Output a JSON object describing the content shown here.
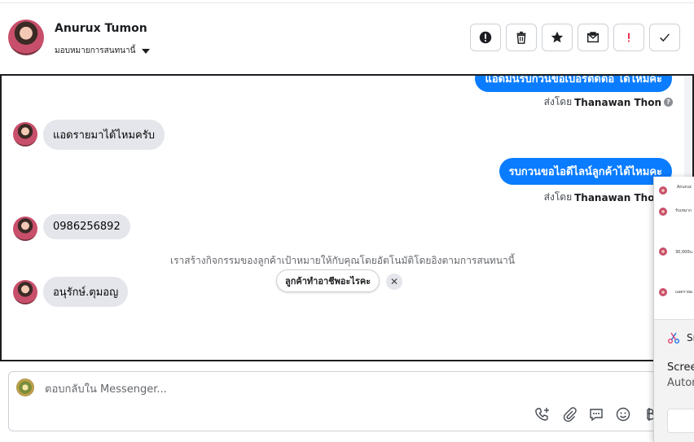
{
  "header": {
    "name": "Anurux Tumon",
    "assign_label": "มอบหมายการสนทนานี้"
  },
  "toolbar": {
    "buttons": [
      "report-icon",
      "trash-icon",
      "star-icon",
      "envelope-icon",
      "exclamation-icon",
      "check-icon"
    ]
  },
  "chat": {
    "messages": [
      {
        "direction": "out",
        "text": "แอดมินรบกวนขอเบอร์ติดต่อ ได้ไหมคะ",
        "sent_by_prefix": "ส่งโดย",
        "sent_by_name": "Thanawan Thon"
      },
      {
        "direction": "in",
        "text": "แอดรายมาได้ไหมครับ"
      },
      {
        "direction": "out",
        "text": "รบกวนขอไอดีไลน์ลูกค้าได้ไหมคะ",
        "sent_by_prefix": "ส่งโดย",
        "sent_by_name": "Thanawan Thon"
      },
      {
        "direction": "in",
        "text": "0986256892"
      },
      {
        "direction": "in",
        "text": "อนุรักษ์.ตุมอญ"
      }
    ],
    "system_note": "เราสร้างกิจกรรมของลูกค้าเป้าหมายให้กับคุณโดยอัตโนมัติโดยอิงตามการสนทนานี้",
    "suggestion_label": "ลูกค้าทำอาชีพอะไรคะ",
    "suggestion_close": "✕"
  },
  "composer": {
    "placeholder": "ตอบกลับใน Messenger..."
  },
  "snip_popup": {
    "thumb_name": "Anurux",
    "thumb_rows": [
      "รับเหมาก",
      "30,000บ.",
      "แอดรายม"
    ],
    "label": "Sn",
    "title": "Scree",
    "subtitle": "Autom"
  },
  "colors": {
    "accent": "#0a7cff",
    "incoming_bubble": "#e4e6eb",
    "toolbar_alert": "#e41e3f"
  }
}
